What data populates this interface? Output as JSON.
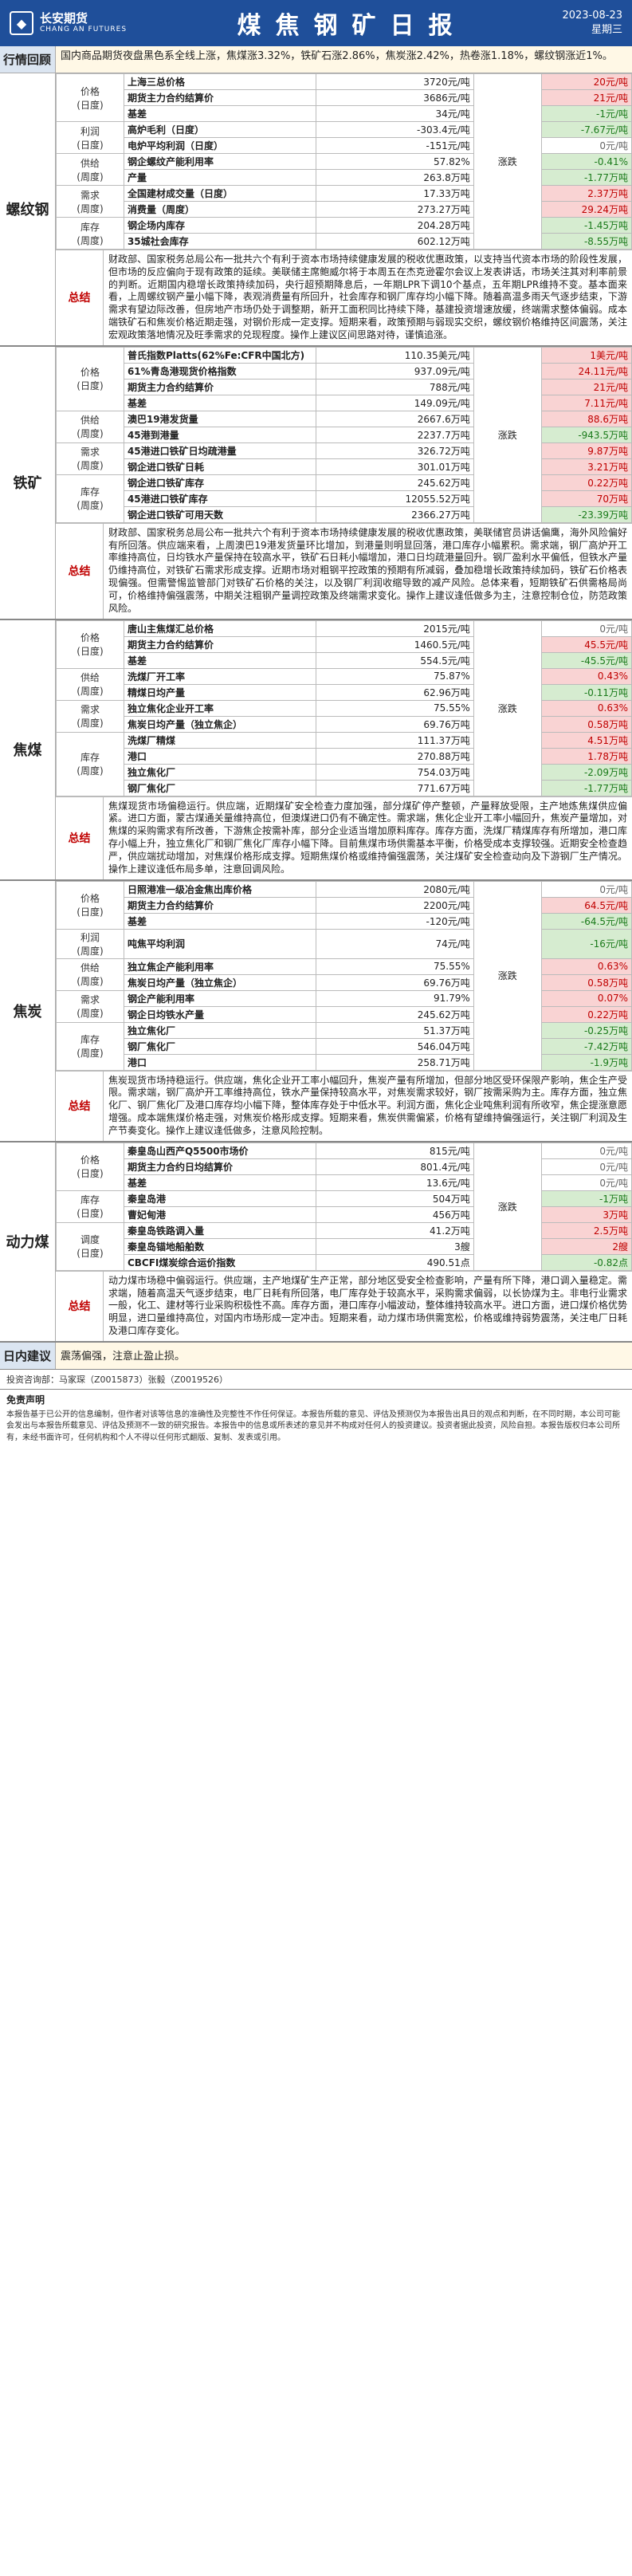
{
  "header": {
    "logo_cn": "长安期货",
    "logo_en": "CHANG AN FUTURES",
    "title": "煤焦钢矿日报",
    "date": "2023-08-23",
    "weekday": "星期三"
  },
  "review": {
    "label": "行情回顾",
    "text": "国内商品期货夜盘黑色系全线上涨，焦煤涨3.32%，铁矿石涨2.86%，焦炭涨2.42%，热卷涨1.18%，螺纹钢涨近1%。"
  },
  "sections": [
    {
      "name": "螺纹钢",
      "rows": [
        {
          "cat": "价格\n(日度)",
          "ind": "上海三总价格",
          "val": "3720元/吨",
          "trend": "",
          "chg": "20元/吨",
          "dir": "up"
        },
        {
          "cat": "",
          "ind": "期货主力合约结算价",
          "val": "3686元/吨",
          "trend": "",
          "chg": "21元/吨",
          "dir": "up"
        },
        {
          "cat": "",
          "ind": "基差",
          "val": "34元/吨",
          "trend": "",
          "chg": "-1元/吨",
          "dir": "down"
        },
        {
          "cat": "利润\n(日度)",
          "ind": "高炉毛利（日度）",
          "val": "-303.4元/吨",
          "trend": "",
          "chg": "-7.67元/吨",
          "dir": "down"
        },
        {
          "cat": "",
          "ind": "电炉平均利润（日度）",
          "val": "-151元/吨",
          "trend": "",
          "chg": "0元/吨",
          "dir": "zero"
        },
        {
          "cat": "供给\n(周度)",
          "ind": "钢企螺纹产能利用率",
          "val": "57.82%",
          "trend": "涨跌",
          "chg": "-0.41%",
          "dir": "down"
        },
        {
          "cat": "",
          "ind": "产量",
          "val": "263.8万吨",
          "trend": "",
          "chg": "-1.77万吨",
          "dir": "down"
        },
        {
          "cat": "需求\n(周度)",
          "ind": "全国建材成交量（日度）",
          "val": "17.33万吨",
          "trend": "",
          "chg": "2.37万吨",
          "dir": "up"
        },
        {
          "cat": "",
          "ind": "消费量（周度）",
          "val": "273.27万吨",
          "trend": "",
          "chg": "29.24万吨",
          "dir": "up"
        },
        {
          "cat": "库存\n(周度)",
          "ind": "钢企场内库存",
          "val": "204.28万吨",
          "trend": "",
          "chg": "-1.45万吨",
          "dir": "down"
        },
        {
          "cat": "",
          "ind": "35城社会库存",
          "val": "602.12万吨",
          "trend": "",
          "chg": "-8.55万吨",
          "dir": "down"
        }
      ],
      "summary": "财政部、国家税务总局公布一批共六个有利于资本市场持续健康发展的税收优惠政策，以支持当代资本市场的阶段性发展，但市场的反应偏向于现有政策的延续。美联储主席鲍威尔将于本周五在杰克逊霍尔会议上发表讲话，市场关注其对利率前景的判断。近期国内稳增长政策持续加码，央行超预期降息后，一年期LPR下调10个基点，五年期LPR维持不变。基本面来看，上周螺纹钢产量小幅下降，表观消费量有所回升，社会库存和钢厂库存均小幅下降。随着高温多雨天气逐步结束，下游需求有望边际改善，但房地产市场仍处于调整期，新开工面积同比持续下降，基建投资增速放缓，终端需求整体偏弱。成本端铁矿石和焦炭价格近期走强，对钢价形成一定支撑。短期来看，政策预期与弱现实交织，螺纹钢价格维持区间震荡，关注宏观政策落地情况及旺季需求的兑现程度。操作上建议区间思路对待，谨慎追涨。"
    },
    {
      "name": "铁矿",
      "rows": [
        {
          "cat": "价格\n(日度)",
          "ind": "普氏指数Platts(62%Fe:CFR中国北方)",
          "val": "110.35美元/吨",
          "trend": "",
          "chg": "1美元/吨",
          "dir": "up"
        },
        {
          "cat": "",
          "ind": "61%青岛港现货价格指数",
          "val": "937.09元/吨",
          "trend": "",
          "chg": "24.11元/吨",
          "dir": "up"
        },
        {
          "cat": "",
          "ind": "期货主力合约结算价",
          "val": "788元/吨",
          "trend": "",
          "chg": "21元/吨",
          "dir": "up"
        },
        {
          "cat": "",
          "ind": "基差",
          "val": "149.09元/吨",
          "trend": "",
          "chg": "7.11元/吨",
          "dir": "up"
        },
        {
          "cat": "供给\n(周度)",
          "ind": "澳巴19港发货量",
          "val": "2667.6万吨",
          "trend": "",
          "chg": "88.6万吨",
          "dir": "up"
        },
        {
          "cat": "",
          "ind": "45港到港量",
          "val": "2237.7万吨",
          "trend": "",
          "chg": "-943.5万吨",
          "dir": "down"
        },
        {
          "cat": "需求\n(周度)",
          "ind": "45港进口铁矿日均疏港量",
          "val": "326.72万吨",
          "trend": "涨跌",
          "chg": "9.87万吨",
          "dir": "up"
        },
        {
          "cat": "",
          "ind": "钢企进口铁矿日耗",
          "val": "301.01万吨",
          "trend": "",
          "chg": "3.21万吨",
          "dir": "up"
        },
        {
          "cat": "库存\n(周度)",
          "ind": "钢企进口铁矿库存",
          "val": "245.62万吨",
          "trend": "",
          "chg": "0.22万吨",
          "dir": "up"
        },
        {
          "cat": "",
          "ind": "45港进口铁矿库存",
          "val": "12055.52万吨",
          "trend": "",
          "chg": "70万吨",
          "dir": "up"
        },
        {
          "cat": "",
          "ind": "钢企进口铁矿可用天数",
          "val": "2366.27万吨",
          "trend": "",
          "chg": "-23.39万吨",
          "dir": "down"
        }
      ],
      "summary": "财政部、国家税务总局公布一批共六个有利于资本市场持续健康发展的税收优惠政策，美联储官员讲话偏鹰，海外风险偏好有所回落。供应端来看，上周澳巴19港发货量环比增加，到港量则明显回落，港口库存小幅累积。需求端，钢厂高炉开工率维持高位，日均铁水产量保持在较高水平，铁矿石日耗小幅增加，港口日均疏港量回升。钢厂盈利水平偏低，但铁水产量仍维持高位，对铁矿石需求形成支撑。近期市场对粗钢平控政策的预期有所减弱，叠加稳增长政策持续加码，铁矿石价格表现偏强。但需警惕监管部门对铁矿石价格的关注，以及钢厂利润收缩导致的减产风险。总体来看，短期铁矿石供需格局尚可，价格维持偏强震荡，中期关注粗钢产量调控政策及终端需求变化。操作上建议逢低做多为主，注意控制仓位，防范政策风险。"
    },
    {
      "name": "焦煤",
      "rows": [
        {
          "cat": "价格\n(日度)",
          "ind": "唐山主焦煤汇总价格",
          "val": "2015元/吨",
          "trend": "",
          "chg": "0元/吨",
          "dir": "zero"
        },
        {
          "cat": "",
          "ind": "期货主力合约结算价",
          "val": "1460.5元/吨",
          "trend": "",
          "chg": "45.5元/吨",
          "dir": "up"
        },
        {
          "cat": "",
          "ind": "基差",
          "val": "554.5元/吨",
          "trend": "",
          "chg": "-45.5元/吨",
          "dir": "down"
        },
        {
          "cat": "供给\n(周度)",
          "ind": "洗煤厂开工率",
          "val": "75.87%",
          "trend": "",
          "chg": "0.43%",
          "dir": "up"
        },
        {
          "cat": "",
          "ind": "精煤日均产量",
          "val": "62.96万吨",
          "trend": "",
          "chg": "-0.11万吨",
          "dir": "down"
        },
        {
          "cat": "需求\n(周度)",
          "ind": "独立焦化企业开工率",
          "val": "75.55%",
          "trend": "涨跌",
          "chg": "0.63%",
          "dir": "up"
        },
        {
          "cat": "",
          "ind": "焦炭日均产量（独立焦企）",
          "val": "69.76万吨",
          "trend": "",
          "chg": "0.58万吨",
          "dir": "up"
        },
        {
          "cat": "库存\n(周度)",
          "ind": "洗煤厂精煤",
          "val": "111.37万吨",
          "trend": "",
          "chg": "4.51万吨",
          "dir": "up"
        },
        {
          "cat": "",
          "ind": "港口",
          "val": "270.88万吨",
          "trend": "",
          "chg": "1.78万吨",
          "dir": "up"
        },
        {
          "cat": "",
          "ind": "独立焦化厂",
          "val": "754.03万吨",
          "trend": "",
          "chg": "-2.09万吨",
          "dir": "down"
        },
        {
          "cat": "",
          "ind": "钢厂焦化厂",
          "val": "771.67万吨",
          "trend": "",
          "chg": "-1.77万吨",
          "dir": "down"
        }
      ],
      "summary": "焦煤现货市场偏稳运行。供应端，近期煤矿安全检查力度加强，部分煤矿停产整顿，产量释放受限，主产地炼焦煤供应偏紧。进口方面，蒙古煤通关量维持高位，但澳煤进口仍有不确定性。需求端，焦化企业开工率小幅回升，焦炭产量增加，对焦煤的采购需求有所改善，下游焦企按需补库，部分企业适当增加原料库存。库存方面，洗煤厂精煤库存有所增加，港口库存小幅上升，独立焦化厂和钢厂焦化厂库存小幅下降。目前焦煤市场供需基本平衡，价格受成本支撑较强。近期安全检查趋严，供应端扰动增加，对焦煤价格形成支撑。短期焦煤价格或维持偏强震荡，关注煤矿安全检查动向及下游钢厂生产情况。操作上建议逢低布局多单，注意回调风险。"
    },
    {
      "name": "焦炭",
      "rows": [
        {
          "cat": "价格\n(日度)",
          "ind": "日照港准一级冶金焦出库价格",
          "val": "2080元/吨",
          "trend": "",
          "chg": "0元/吨",
          "dir": "zero"
        },
        {
          "cat": "",
          "ind": "期货主力合约结算价",
          "val": "2200元/吨",
          "trend": "",
          "chg": "64.5元/吨",
          "dir": "up"
        },
        {
          "cat": "",
          "ind": "基差",
          "val": "-120元/吨",
          "trend": "",
          "chg": "-64.5元/吨",
          "dir": "down"
        },
        {
          "cat": "利润\n(周度)",
          "ind": "吨焦平均利润",
          "val": "74元/吨",
          "trend": "",
          "chg": "-16元/吨",
          "dir": "down"
        },
        {
          "cat": "供给\n(周度)",
          "ind": "独立焦企产能利用率",
          "val": "75.55%",
          "trend": "",
          "chg": "0.63%",
          "dir": "up"
        },
        {
          "cat": "",
          "ind": "焦炭日均产量（独立焦企）",
          "val": "69.76万吨",
          "trend": "",
          "chg": "0.58万吨",
          "dir": "up"
        },
        {
          "cat": "需求\n(周度)",
          "ind": "钢企产能利用率",
          "val": "91.79%",
          "trend": "涨跌",
          "chg": "0.07%",
          "dir": "up"
        },
        {
          "cat": "",
          "ind": "钢企日均铁水产量",
          "val": "245.62万吨",
          "trend": "",
          "chg": "0.22万吨",
          "dir": "up"
        },
        {
          "cat": "库存\n(周度)",
          "ind": "独立焦化厂",
          "val": "51.37万吨",
          "trend": "",
          "chg": "-0.25万吨",
          "dir": "down"
        },
        {
          "cat": "",
          "ind": "钢厂焦化厂",
          "val": "546.04万吨",
          "trend": "",
          "chg": "-7.42万吨",
          "dir": "down"
        },
        {
          "cat": "",
          "ind": "港口",
          "val": "258.71万吨",
          "trend": "",
          "chg": "-1.9万吨",
          "dir": "down"
        }
      ],
      "summary": "焦炭现货市场持稳运行。供应端，焦化企业开工率小幅回升，焦炭产量有所增加，但部分地区受环保限产影响，焦企生产受限。需求端，钢厂高炉开工率维持高位，铁水产量保持较高水平，对焦炭需求较好，钢厂按需采购为主。库存方面，独立焦化厂、钢厂焦化厂及港口库存均小幅下降，整体库存处于中低水平。利润方面，焦化企业吨焦利润有所收窄，焦企提涨意愿增强。成本端焦煤价格走强，对焦炭价格形成支撑。短期来看，焦炭供需偏紧，价格有望维持偏强运行，关注钢厂利润及生产节奏变化。操作上建议逢低做多，注意风险控制。"
    },
    {
      "name": "动力煤",
      "rows": [
        {
          "cat": "价格\n(日度)",
          "ind": "秦皇岛山西产Q5500市场价",
          "val": "815元/吨",
          "trend": "",
          "chg": "0元/吨",
          "dir": "zero"
        },
        {
          "cat": "",
          "ind": "期货主力合约日均结算价",
          "val": "801.4元/吨",
          "trend": "",
          "chg": "0元/吨",
          "dir": "zero"
        },
        {
          "cat": "",
          "ind": "基差",
          "val": "13.6元/吨",
          "trend": "",
          "chg": "0元/吨",
          "dir": "zero"
        },
        {
          "cat": "库存\n(日度)",
          "ind": "秦皇岛港",
          "val": "504万吨",
          "trend": "",
          "chg": "-1万吨",
          "dir": "down"
        },
        {
          "cat": "",
          "ind": "曹妃甸港",
          "val": "456万吨",
          "trend": "涨跌",
          "chg": "3万吨",
          "dir": "up"
        },
        {
          "cat": "调度\n(日度)",
          "ind": "秦皇岛铁路调入量",
          "val": "41.2万吨",
          "trend": "",
          "chg": "2.5万吨",
          "dir": "up"
        },
        {
          "cat": "",
          "ind": "秦皇岛锚地船舶数",
          "val": "3艘",
          "trend": "",
          "chg": "2艘",
          "dir": "up"
        },
        {
          "cat": "",
          "ind": "CBCFI煤炭综合运价指数",
          "val": "490.51点",
          "trend": "",
          "chg": "-0.82点",
          "dir": "down"
        }
      ],
      "summary": "动力煤市场稳中偏弱运行。供应端，主产地煤矿生产正常，部分地区受安全检查影响，产量有所下降，港口调入量稳定。需求端，随着高温天气逐步结束，电厂日耗有所回落，电厂库存处于较高水平，采购需求偏弱，以长协煤为主。非电行业需求一般，化工、建材等行业采购积极性不高。库存方面，港口库存小幅波动，整体维持较高水平。进口方面，进口煤价格优势明显，进口量维持高位，对国内市场形成一定冲击。短期来看，动力煤市场供需宽松，价格或维持弱势震荡，关注电厂日耗及港口库存变化。"
    }
  ],
  "advice": {
    "label": "日内建议",
    "text": "震荡偏强，注意止盈止损。"
  },
  "footer": {
    "analyst": "投资咨询部：马家琛（Z0015873）张毅（Z0019526）",
    "disclaimer_title": "免责声明",
    "disclaimer": "本报告基于已公开的信息编制，但作者对该等信息的准确性及完整性不作任何保证。本报告所载的意见、评估及预测仅为本报告出具日的观点和判断，在不同时期，本公司可能会发出与本报告所载意见、评估及预测不一致的研究报告。本报告中的信息或所表述的意见并不构成对任何人的投资建议。投资者据此投资，风险自担。本报告版权归本公司所有，未经书面许可，任何机构和个人不得以任何形式翻版、复制、发表或引用。"
  }
}
